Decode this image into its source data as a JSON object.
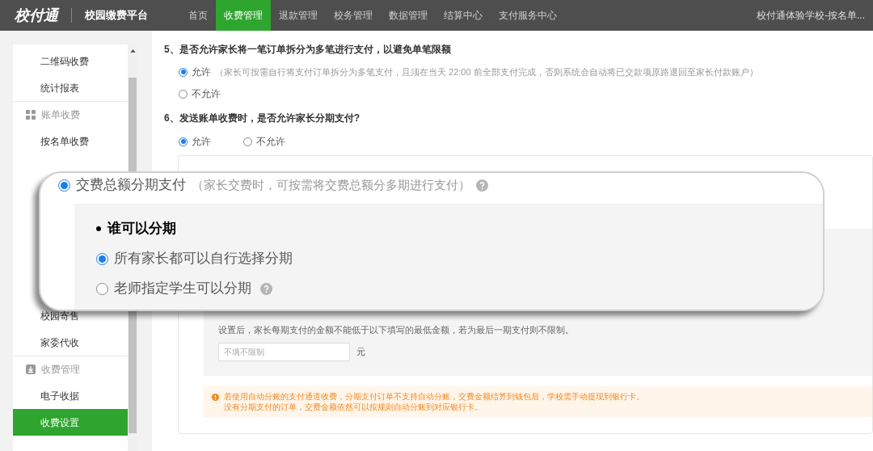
{
  "header": {
    "logo": "校付通",
    "platform": "校园缴费平台",
    "nav": [
      {
        "label": "首页",
        "selected": false
      },
      {
        "label": "收费管理",
        "selected": true
      },
      {
        "label": "退款管理",
        "selected": false
      },
      {
        "label": "校务管理",
        "selected": false
      },
      {
        "label": "数据管理",
        "selected": false
      },
      {
        "label": "结算中心",
        "selected": false
      },
      {
        "label": "支付服务中心",
        "selected": false
      }
    ],
    "account": "校付通体验学校-按名单..."
  },
  "sidebar": {
    "top_items": [
      {
        "kind": "item",
        "label": "二维码收费",
        "selected": false
      },
      {
        "kind": "item",
        "label": "统计报表",
        "selected": false
      },
      {
        "kind": "group",
        "label": "账单收费"
      },
      {
        "kind": "item",
        "label": "按名单收费",
        "selected": false
      }
    ],
    "bottom_items": [
      {
        "kind": "item",
        "label": "校园寄售",
        "selected": false
      },
      {
        "kind": "item",
        "label": "家委代收",
        "selected": false
      },
      {
        "kind": "group",
        "label": "收费管理"
      },
      {
        "kind": "item",
        "label": "电子收据",
        "selected": false
      },
      {
        "kind": "item",
        "label": "收费设置",
        "selected": true
      }
    ]
  },
  "settings": [
    {
      "title": "5、是否允许家长将一笔订单拆分为多笔进行支付，以避免单笔限额",
      "inline": false,
      "options": [
        {
          "label": "允许",
          "note": "（家长可按需自行将支付订单拆分为多笔支付，且须在当天 22:00 前全部支付完成，否则系统会自动将已交款项原路退回至家长付款账户）",
          "selected": true
        },
        {
          "label": "不允许",
          "selected": false
        }
      ]
    },
    {
      "title": "6、发送账单收费时，是否允许家长分期支付?",
      "inline": true,
      "options": [
        {
          "label": "允许",
          "selected": true
        },
        {
          "label": "不允许",
          "selected": false
        }
      ]
    }
  ],
  "installment": {
    "min_amount_hint": "设置后，家长每期支付的金额不能低于以下填写的最低金额，若为最后一期支付则不限制。",
    "input_placeholder": "不填不限制",
    "unit": "元",
    "notice": [
      "若使用自动分账的支付通道收费，分期支付订单不支持自动分账，交费金额结算到钱包后，学校需手动提现到银行卡。",
      "没有分期支付的订单，交费金额依然可以按规则自动分账到对应银行卡。"
    ]
  },
  "callout": {
    "mode": {
      "label": "交费总额分期支付",
      "note": "（家长交费时，可按需将交费总额分多期进行支付）",
      "selected": true,
      "help": true
    },
    "section_title": "谁可以分期",
    "options": [
      {
        "label": "所有家长都可以自行选择分期",
        "selected": true,
        "help": false
      },
      {
        "label": "老师指定学生可以分期",
        "selected": false,
        "help": true
      }
    ]
  }
}
